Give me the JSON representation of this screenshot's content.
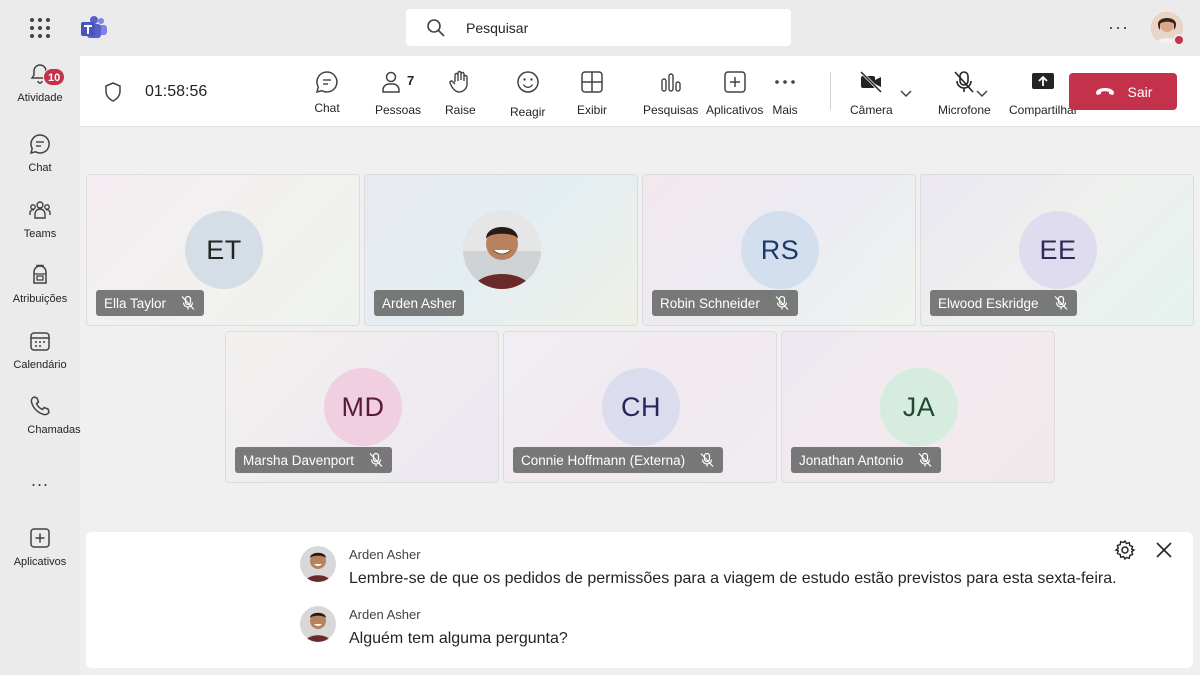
{
  "topbar": {
    "search_placeholder": "Pesquisar",
    "more_icon": "more-horizontal-icon"
  },
  "rail": {
    "items": [
      {
        "label": "Atividade",
        "icon": "bell-icon",
        "badge": "10"
      },
      {
        "label": "Chat",
        "icon": "chat-icon"
      },
      {
        "label": "Teams",
        "icon": "teams-people-icon"
      },
      {
        "label": "Atribuições",
        "icon": "backpack-icon"
      },
      {
        "label": "Calendário",
        "icon": "calendar-icon"
      },
      {
        "label": "Chamadas",
        "icon": "phone-icon"
      },
      {
        "label": "...",
        "icon": "more-horizontal-icon"
      },
      {
        "label": "Aplicativos",
        "icon": "add-app-icon"
      }
    ]
  },
  "meeting": {
    "timer": "01:58:56",
    "toolbar": {
      "chat": "Chat",
      "people": "Pessoas",
      "people_count": "7",
      "raise": "Raise",
      "react": "Reagir",
      "view": "Exibir",
      "polls": "Pesquisas",
      "apps": "Aplicativos",
      "more": "Mais",
      "camera": "Câmera",
      "mic": "Microfone",
      "share": "Compartilhar",
      "leave": "Sair"
    }
  },
  "participants": [
    {
      "name": "Ella Taylor",
      "initials": "ET",
      "muted": true,
      "avatar_bg": "#d5dde6",
      "initials_color": "#242424"
    },
    {
      "name": "Arden Asher",
      "initials": "",
      "photo": true,
      "muted": false
    },
    {
      "name": "Robin Schneider",
      "initials": "RS",
      "muted": true,
      "avatar_bg": "#d3dfee",
      "initials_color": "#1b3a66"
    },
    {
      "name": "Elwood Eskridge",
      "initials": "EE",
      "muted": true,
      "avatar_bg": "#e0dcef",
      "initials_color": "#2c2a5a"
    },
    {
      "name": "Marsha Davenport",
      "initials": "MD",
      "muted": true,
      "avatar_bg": "#efcfe0",
      "initials_color": "#5a1a3e"
    },
    {
      "name": "Connie Hoffmann (Externa)",
      "initials": "CH",
      "muted": true,
      "avatar_bg": "#dcdcef",
      "initials_color": "#26265a"
    },
    {
      "name": "Jonathan Antonio",
      "initials": "JA",
      "muted": true,
      "avatar_bg": "#d6ece0",
      "initials_color": "#1d4a30"
    }
  ],
  "captions": [
    {
      "speaker": "Arden Asher",
      "text": "Lembre-se de que os pedidos de permissões para a viagem de estudo estão previstos para esta sexta-feira."
    },
    {
      "speaker": "Arden Asher",
      "text": "Alguém tem alguma pergunta?"
    }
  ],
  "colors": {
    "leave": "#c4314b",
    "badge": "#c4314b",
    "brand": "#5b5fc7"
  }
}
